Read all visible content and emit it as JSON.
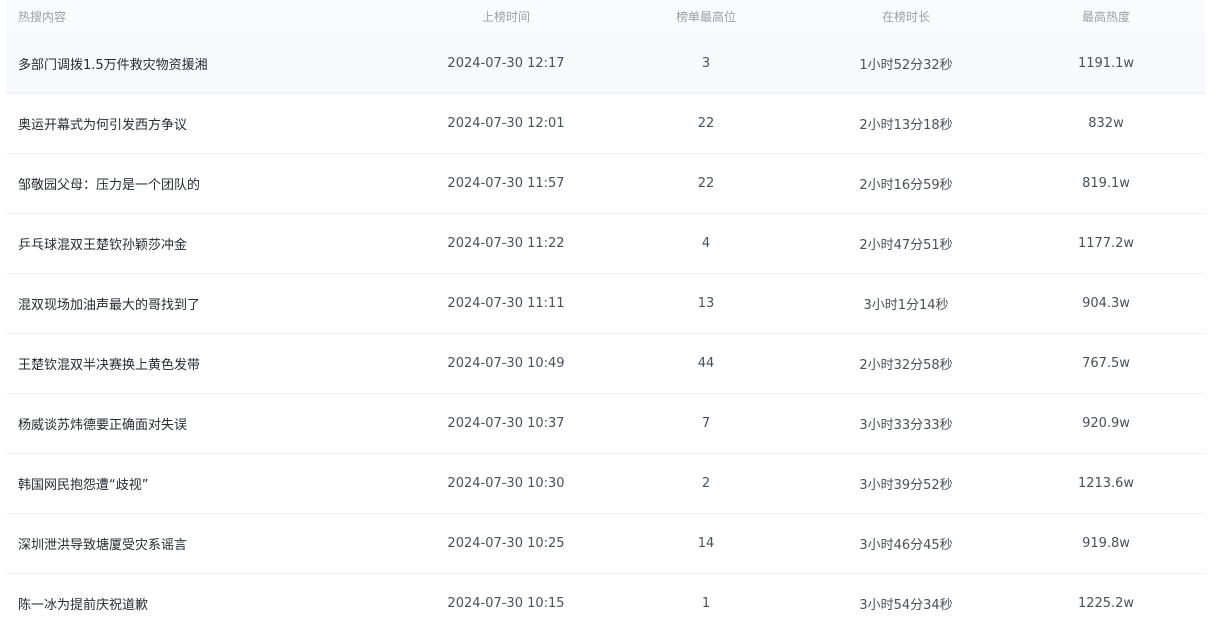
{
  "table": {
    "headers": {
      "title": "热搜内容",
      "time": "上榜时间",
      "rank": "榜单最高位",
      "duration": "在榜时长",
      "heat": "最高热度"
    },
    "rows": [
      {
        "title": "多部门调拨1.5万件救灾物资援湘",
        "time": "2024-07-30 12:17",
        "rank": "3",
        "duration": "1小时52分32秒",
        "heat": "1191.1w"
      },
      {
        "title": "奥运开幕式为何引发西方争议",
        "time": "2024-07-30 12:01",
        "rank": "22",
        "duration": "2小时13分18秒",
        "heat": "832w"
      },
      {
        "title": "邹敬园父母：压力是一个团队的",
        "time": "2024-07-30 11:57",
        "rank": "22",
        "duration": "2小时16分59秒",
        "heat": "819.1w"
      },
      {
        "title": "乒乓球混双王楚钦孙颖莎冲金",
        "time": "2024-07-30 11:22",
        "rank": "4",
        "duration": "2小时47分51秒",
        "heat": "1177.2w"
      },
      {
        "title": "混双现场加油声最大的哥找到了",
        "time": "2024-07-30 11:11",
        "rank": "13",
        "duration": "3小时1分14秒",
        "heat": "904.3w"
      },
      {
        "title": "王楚钦混双半决赛换上黄色发带",
        "time": "2024-07-30 10:49",
        "rank": "44",
        "duration": "2小时32分58秒",
        "heat": "767.5w"
      },
      {
        "title": "杨威谈苏炜德要正确面对失误",
        "time": "2024-07-30 10:37",
        "rank": "7",
        "duration": "3小时33分33秒",
        "heat": "920.9w"
      },
      {
        "title": "韩国网民抱怨遭“歧视”",
        "time": "2024-07-30 10:30",
        "rank": "2",
        "duration": "3小时39分52秒",
        "heat": "1213.6w"
      },
      {
        "title": "深圳泄洪导致塘厦受灾系谣言",
        "time": "2024-07-30 10:25",
        "rank": "14",
        "duration": "3小时46分45秒",
        "heat": "919.8w"
      },
      {
        "title": "陈一冰为提前庆祝道歉",
        "time": "2024-07-30 10:15",
        "rank": "1",
        "duration": "3小时54分34秒",
        "heat": "1225.2w"
      }
    ]
  }
}
